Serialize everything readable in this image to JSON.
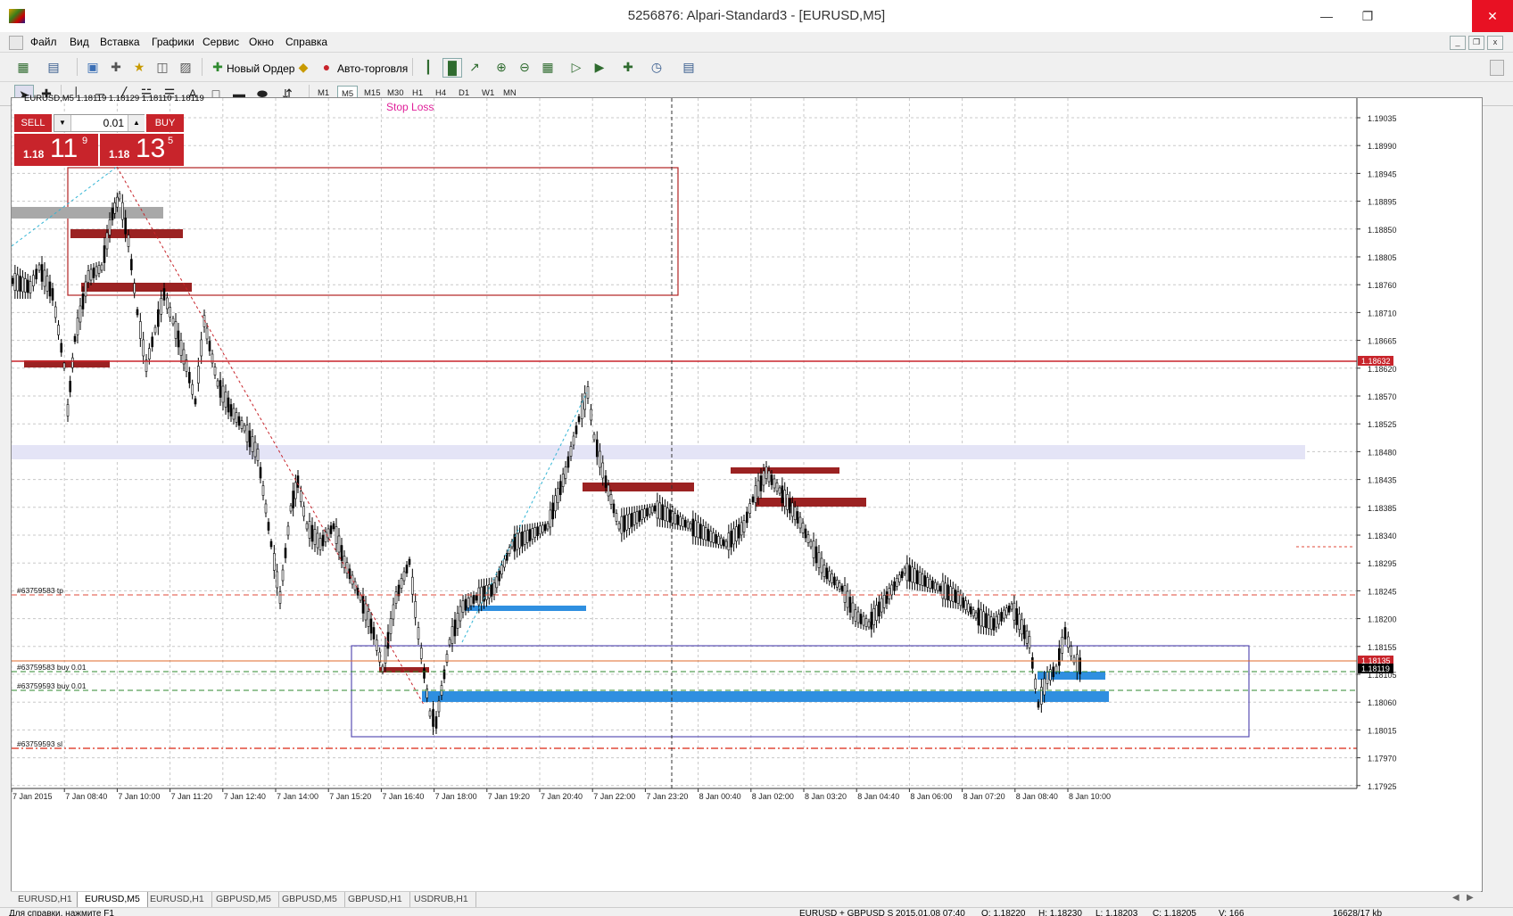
{
  "window": {
    "title": "5256876: Alpari-Standard3 - [EURUSD,M5]"
  },
  "menu": [
    "Файл",
    "Вид",
    "Вставка",
    "Графики",
    "Сервис",
    "Окно",
    "Справка"
  ],
  "toolbar": {
    "new_order": "Новый Ордер",
    "auto_trading": "Авто-торговля"
  },
  "timeframes": [
    "M1",
    "M5",
    "M15",
    "M30",
    "H1",
    "H4",
    "D1",
    "W1",
    "MN"
  ],
  "active_timeframe": "M5",
  "chart": {
    "header": "EURUSD,M5  1.18119 1.18129 1.18110 1.18119",
    "stop_loss_label": "Stop Loss",
    "price_labels": [
      "1.19035",
      "1.18990",
      "1.18945",
      "1.18895",
      "1.18850",
      "1.18805",
      "1.18760",
      "1.18710",
      "1.18665",
      "1.18620",
      "1.18570",
      "1.18525",
      "1.18480",
      "1.18435",
      "1.18385",
      "1.18340",
      "1.18295",
      "1.18245",
      "1.18200",
      "1.18155",
      "1.18105",
      "1.18060",
      "1.18015",
      "1.17970",
      "1.17925"
    ],
    "time_labels": [
      "7 Jan 2015",
      "7 Jan 08:40",
      "7 Jan 10:00",
      "7 Jan 11:20",
      "7 Jan 12:40",
      "7 Jan 14:00",
      "7 Jan 15:20",
      "7 Jan 16:40",
      "7 Jan 18:00",
      "7 Jan 19:20",
      "7 Jan 20:40",
      "7 Jan 22:00",
      "7 Jan 23:20",
      "8 Jan 00:40",
      "8 Jan 02:00",
      "8 Jan 03:20",
      "8 Jan 04:40",
      "8 Jan 06:00",
      "8 Jan 07:20",
      "8 Jan 08:40",
      "8 Jan 10:00"
    ],
    "level_tags": {
      "red_line": "1.18632",
      "orange_line": "1.18135",
      "current": "1.18119"
    },
    "order_labels": {
      "tp": "#63759583 tp",
      "buy1": "#63759583 buy 0.01",
      "buy2": "#63759593 buy 0.01",
      "sl": "#63759593 sl"
    }
  },
  "oneclick": {
    "sell": "SELL",
    "buy": "BUY",
    "lot": "0.01",
    "sell_small": "1.18",
    "sell_big": "11",
    "sell_sup": "9",
    "buy_small": "1.18",
    "buy_big": "13",
    "buy_sup": "5"
  },
  "tabs": [
    "EURUSD,H1",
    "EURUSD,M5",
    "EURUSD,H1",
    "GBPUSD,M5",
    "GBPUSD,M5",
    "GBPUSD,H1",
    "USDRUB,H1"
  ],
  "active_tab_index": 1,
  "status": {
    "help": "Для справки, нажмите F1",
    "profile": "EURUSD + GBPUSD S",
    "datetime": "2015.01.08 07:40",
    "open": "O: 1.18220",
    "high": "H: 1.18230",
    "low": "L: 1.18203",
    "close": "C: 1.18205",
    "volume": "V: 166",
    "traffic": "16628/17 kb"
  }
}
